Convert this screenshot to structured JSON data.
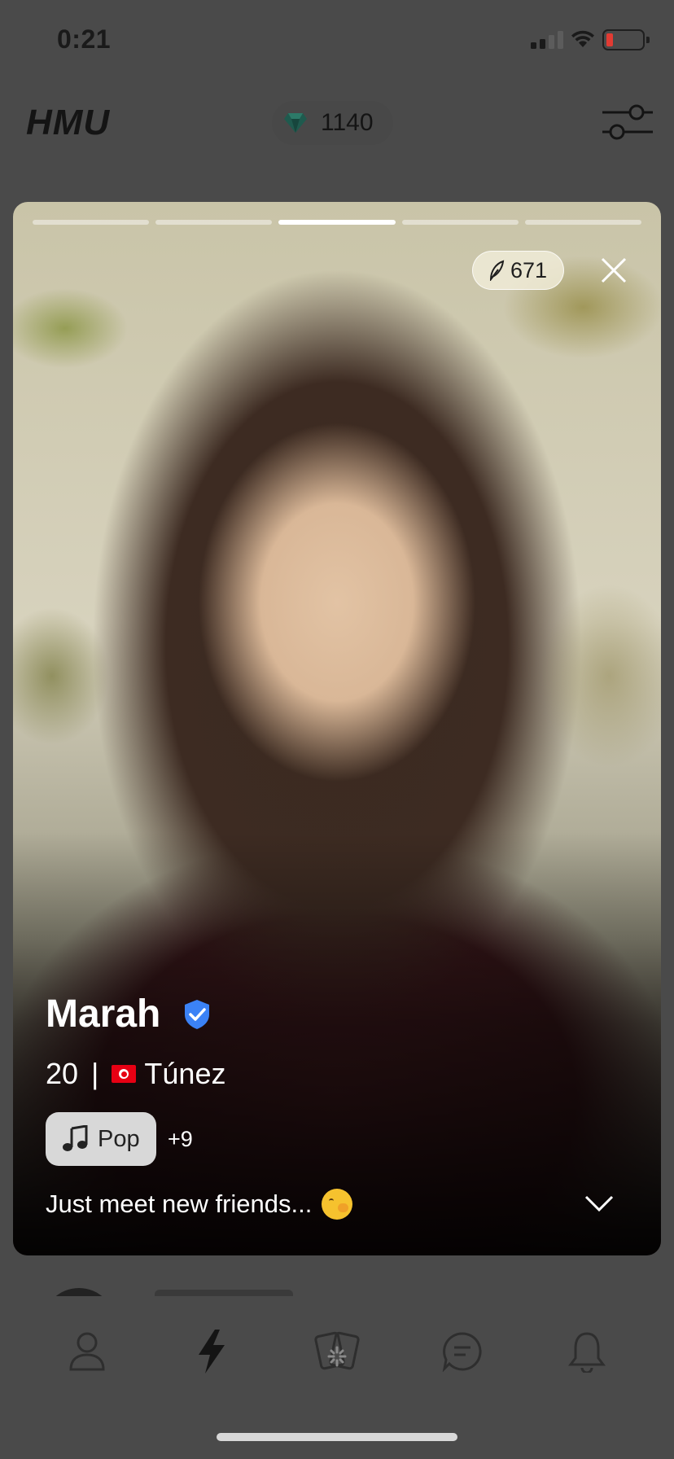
{
  "status_bar": {
    "time": "0:21"
  },
  "header": {
    "logo": "HMU",
    "gem_count": "1140"
  },
  "card": {
    "photo_count": 5,
    "active_photo_index": 2,
    "likes": "671",
    "name": "Marah",
    "age": "20",
    "separator": "|",
    "country": "Túnez",
    "interest": "Pop",
    "more_interests": "+9",
    "bio": "Just meet new friends..."
  },
  "nav": {
    "items": [
      "profile-icon",
      "lightning-icon",
      "cards-icon",
      "chat-icon",
      "bell-icon"
    ],
    "active": "lightning-icon"
  },
  "colors": {
    "background": "#4a4a4a",
    "verified": "#3b82f6",
    "battery_low": "#e23b33"
  }
}
